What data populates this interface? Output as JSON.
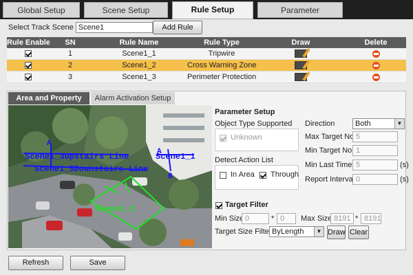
{
  "nav_tabs": [
    "Global Setup",
    "Scene Setup",
    "Rule Setup",
    "Parameter"
  ],
  "track_scene": {
    "label": "Select Track Scene",
    "value": "Scene1",
    "add_rule": "Add Rule"
  },
  "table": {
    "headers": [
      "Rule Enable",
      "SN",
      "Rule Name",
      "Rule Type",
      "Draw",
      "Delete"
    ],
    "rows": [
      {
        "sn": "1",
        "name": "Scene1_1",
        "type": "Tripwire"
      },
      {
        "sn": "2",
        "name": "Scene1_2",
        "type": "Cross Warning Zone"
      },
      {
        "sn": "3",
        "name": "Scene1_3",
        "type": "Perimeter Protection"
      }
    ]
  },
  "sub_tabs": [
    "Area and Property Setup",
    "Alarm Activation Setup"
  ],
  "video_overlay": {
    "line_upstairs": "Scene1_3Upstairs Line",
    "line_downstairs": "Scene1_3Downstairs Line",
    "tripwire": "Scene1_1",
    "zone": "Scene1_2",
    "marker_a": "A",
    "marker_b": "B",
    "marker_a2": "A"
  },
  "param": {
    "title": "Parameter Setup",
    "object_type_label": "Object Type Supported",
    "object_unknown": "Unknown",
    "detect_label": "Detect Action List",
    "in_area": "In Area",
    "through": "Through",
    "direction_label": "Direction",
    "direction_value": "Both",
    "max_target_label": "Max Target No.",
    "max_target": "5",
    "min_target_label": "Min Target No.",
    "min_target": "1",
    "min_last_label": "Min Last Time",
    "min_last": "5",
    "report_label": "Report Interval",
    "report": "0",
    "unit_s": "(s)",
    "target_filter": "Target Filter",
    "min_size_label": "Min Size",
    "min_w": "0",
    "min_h": "0",
    "max_size_label": "Max Size",
    "max_w": "8191",
    "max_h": "8191",
    "times": "*",
    "filter_label": "Target Size Filter",
    "filter_value": "ByLength",
    "draw": "Draw",
    "clear": "Clear"
  },
  "footer": {
    "refresh": "Refresh",
    "save": "Save"
  },
  "colors": {
    "selected_row": "#f5c04b",
    "header_bar": "#5c5c5c"
  }
}
